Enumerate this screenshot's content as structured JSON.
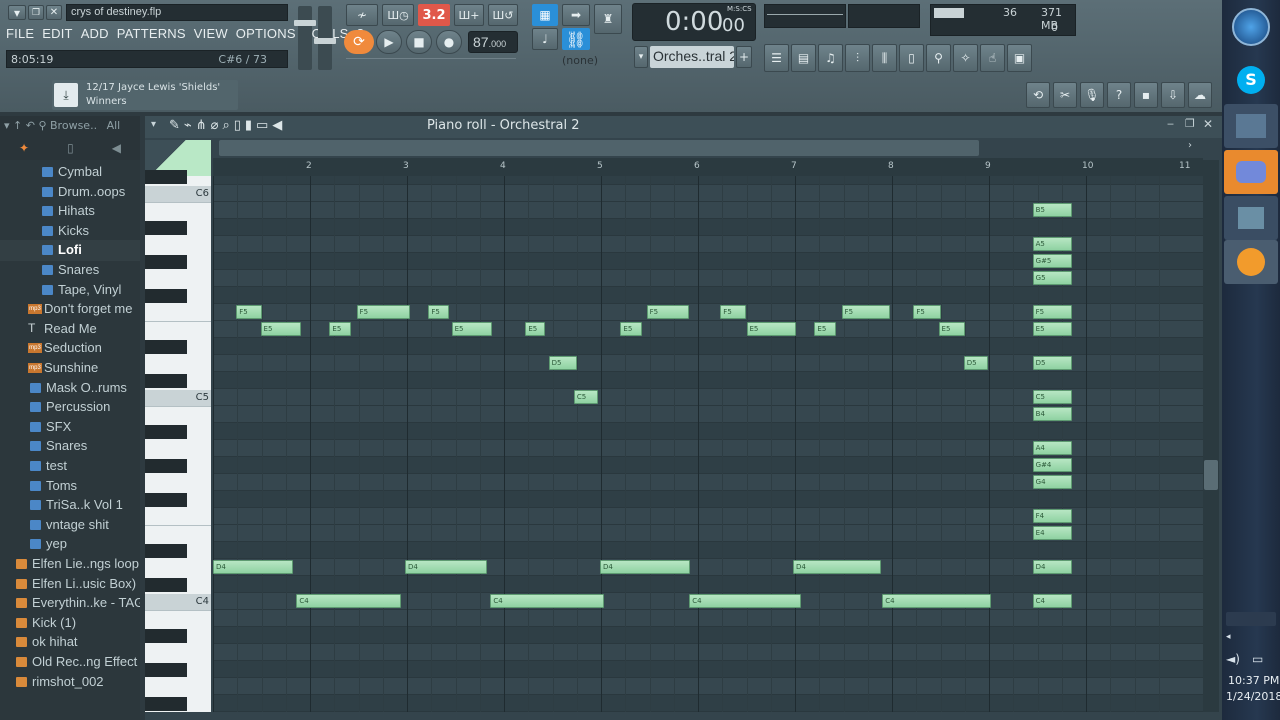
{
  "title": {
    "filename": "crys of destiney.flp",
    "hint": "8:05:19",
    "pos": "C#6 / 73"
  },
  "menu": [
    "FILE",
    "EDIT",
    "ADD",
    "PATTERNS",
    "VIEW",
    "OPTIONS",
    "TOOLS",
    "?"
  ],
  "transport": {
    "mode_label": "3.2",
    "tempo": "87",
    "tempo_dec": ".000",
    "time_main": "0:00",
    "time_sub": "00",
    "time_mode": "M:S:CS",
    "pattern": "(none)"
  },
  "channel": {
    "name": "Orches..tral 2",
    "add": "+"
  },
  "meter": {
    "cpu": "36",
    "mem": "371 MB",
    "poly": "0"
  },
  "hint_bar": {
    "line1": "12/17  Jayce Lewis 'Shields'",
    "line2": "Winners"
  },
  "browser": {
    "header": {
      "label": "Browse..",
      "filter": "All"
    },
    "items": [
      {
        "label": "Cymbal",
        "type": "folder"
      },
      {
        "label": "Drum..oops",
        "type": "folder"
      },
      {
        "label": "Hihats",
        "type": "folder"
      },
      {
        "label": "Kicks",
        "type": "folder"
      },
      {
        "label": "Lofi",
        "type": "folder"
      },
      {
        "label": "Snares",
        "type": "folder"
      },
      {
        "label": "Tape, Vinyl",
        "type": "folder"
      },
      {
        "label": "Don't forget me",
        "type": "mp3"
      },
      {
        "label": "Read Me",
        "type": "text"
      },
      {
        "label": "Seduction",
        "type": "mp3"
      },
      {
        "label": "Sunshine",
        "type": "mp3"
      },
      {
        "label": "Mask O..rums",
        "type": "folder"
      },
      {
        "label": "Percussion",
        "type": "folder"
      },
      {
        "label": "SFX",
        "type": "folder"
      },
      {
        "label": "Snares",
        "type": "folder"
      },
      {
        "label": "test",
        "type": "folder"
      },
      {
        "label": "Toms",
        "type": "folder"
      },
      {
        "label": "TriSa..k Vol 1",
        "type": "folder"
      },
      {
        "label": "vntage shit",
        "type": "folder"
      },
      {
        "label": "yep",
        "type": "folder"
      },
      {
        "label": "Elfen Lie..ngs loop",
        "type": "pack"
      },
      {
        "label": "Elfen Li..usic Box)",
        "type": "pack"
      },
      {
        "label": "Everythin..ke - TAG",
        "type": "pack"
      },
      {
        "label": "Kick (1)",
        "type": "pack"
      },
      {
        "label": "ok hihat",
        "type": "pack"
      },
      {
        "label": "Old Rec..ng Effect",
        "type": "pack"
      },
      {
        "label": "rimshot_002",
        "type": "pack"
      }
    ]
  },
  "piano_roll": {
    "title": "Piano roll - Orchestral 2",
    "bars": [
      "2",
      "3",
      "4",
      "5",
      "6",
      "7",
      "8",
      "9",
      "10",
      "11"
    ],
    "octave_labels": [
      "C6",
      "C5",
      "C4"
    ],
    "notes": [
      {
        "n": "F5",
        "bar": 1.24,
        "len": 0.27
      },
      {
        "n": "E5",
        "bar": 1.49,
        "len": 0.42
      },
      {
        "n": "E5",
        "bar": 2.2,
        "len": 0.22
      },
      {
        "n": "F5",
        "bar": 2.48,
        "len": 0.55
      },
      {
        "n": "F5",
        "bar": 3.22,
        "len": 0.21
      },
      {
        "n": "E5",
        "bar": 3.46,
        "len": 0.42
      },
      {
        "n": "E5",
        "bar": 4.22,
        "len": 0.2
      },
      {
        "n": "D5",
        "bar": 4.46,
        "len": 0.29
      },
      {
        "n": "C5",
        "bar": 4.72,
        "len": 0.25
      },
      {
        "n": "E5",
        "bar": 5.2,
        "len": 0.22
      },
      {
        "n": "F5",
        "bar": 5.47,
        "len": 0.44
      },
      {
        "n": "F5",
        "bar": 6.23,
        "len": 0.27
      },
      {
        "n": "E5",
        "bar": 6.5,
        "len": 0.51
      },
      {
        "n": "E5",
        "bar": 7.2,
        "len": 0.22
      },
      {
        "n": "F5",
        "bar": 7.48,
        "len": 0.5
      },
      {
        "n": "F5",
        "bar": 8.22,
        "len": 0.29
      },
      {
        "n": "E5",
        "bar": 8.48,
        "len": 0.27
      },
      {
        "n": "D5",
        "bar": 8.74,
        "len": 0.25
      },
      {
        "n": "D4",
        "bar": 1.0,
        "len": 0.82
      },
      {
        "n": "C4",
        "bar": 1.86,
        "len": 1.08
      },
      {
        "n": "D4",
        "bar": 2.98,
        "len": 0.85
      },
      {
        "n": "C4",
        "bar": 3.86,
        "len": 1.17
      },
      {
        "n": "D4",
        "bar": 4.99,
        "len": 0.93
      },
      {
        "n": "C4",
        "bar": 5.91,
        "len": 1.15
      },
      {
        "n": "D4",
        "bar": 6.98,
        "len": 0.91
      },
      {
        "n": "C4",
        "bar": 7.9,
        "len": 1.12
      },
      {
        "n": "B5",
        "bar": 9.45,
        "len": 0.41
      },
      {
        "n": "A5",
        "bar": 9.45,
        "len": 0.41
      },
      {
        "n": "G#5",
        "bar": 9.45,
        "len": 0.41
      },
      {
        "n": "G5",
        "bar": 9.45,
        "len": 0.41
      },
      {
        "n": "F5",
        "bar": 9.45,
        "len": 0.41
      },
      {
        "n": "E5",
        "bar": 9.45,
        "len": 0.41
      },
      {
        "n": "D5",
        "bar": 9.45,
        "len": 0.41
      },
      {
        "n": "C5",
        "bar": 9.45,
        "len": 0.41
      },
      {
        "n": "B4",
        "bar": 9.45,
        "len": 0.41
      },
      {
        "n": "A4",
        "bar": 9.45,
        "len": 0.41
      },
      {
        "n": "G#4",
        "bar": 9.45,
        "len": 0.41
      },
      {
        "n": "G4",
        "bar": 9.45,
        "len": 0.41
      },
      {
        "n": "F4",
        "bar": 9.45,
        "len": 0.41
      },
      {
        "n": "E4",
        "bar": 9.45,
        "len": 0.41
      },
      {
        "n": "D4",
        "bar": 9.45,
        "len": 0.41
      },
      {
        "n": "C4",
        "bar": 9.45,
        "len": 0.41
      }
    ]
  },
  "clock": {
    "time": "10:37 PM",
    "date": "1/24/2018"
  },
  "colors": {
    "note": "#9fdcb0",
    "accent": "#f08a3c",
    "mode_red": "#e0584a",
    "grid": "#34454d"
  }
}
